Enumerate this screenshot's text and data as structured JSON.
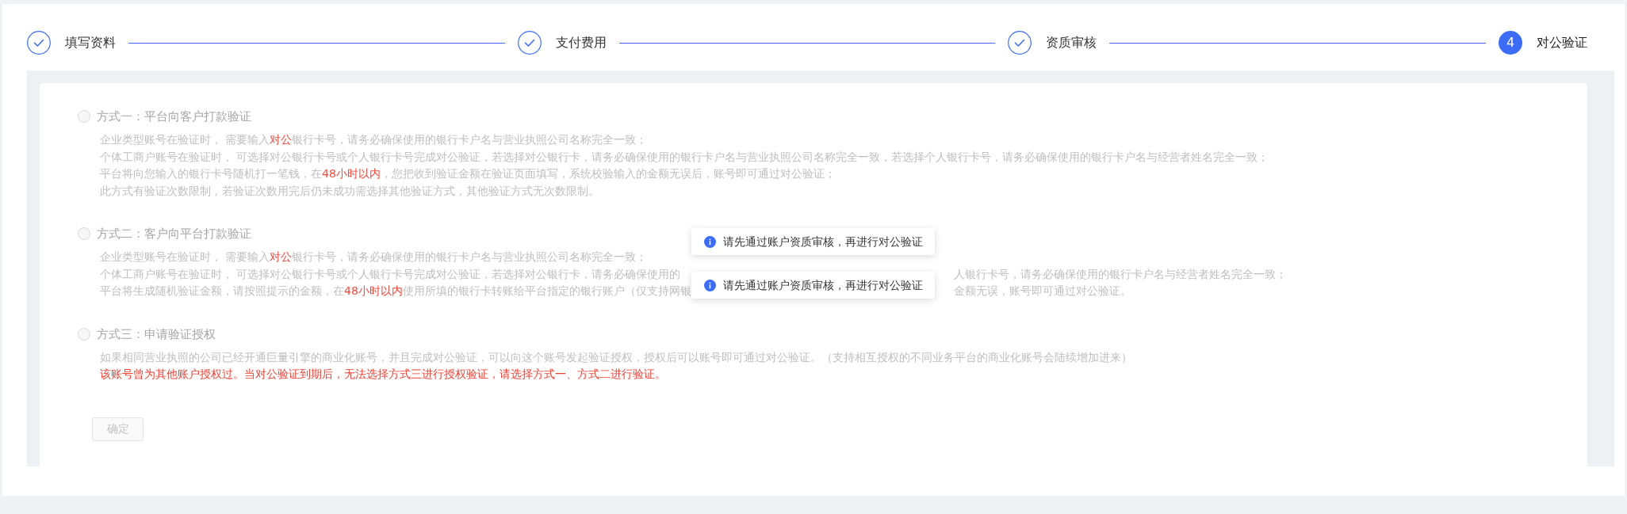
{
  "steps": [
    {
      "label": "填写资料",
      "completed": true
    },
    {
      "label": "支付费用",
      "completed": true
    },
    {
      "label": "资质审核",
      "completed": true
    },
    {
      "label": "对公验证",
      "completed": false,
      "number": "4"
    }
  ],
  "methods": [
    {
      "title": "方式一：平台向客户打款验证",
      "selected": false,
      "disabled": true,
      "lines": [
        {
          "kind": "normal",
          "segments": [
            {
              "text": "企业类型账号在验证时， 需要输入",
              "highlight": false
            },
            {
              "text": "对公",
              "highlight": true
            },
            {
              "text": "银行卡号，请务必确保使用的银行卡户名与营业执照公司名称完全一致；",
              "highlight": false
            }
          ]
        },
        {
          "kind": "normal",
          "segments": [
            {
              "text": "个体工商户账号在验证时， 可选择对公银行卡号或个人银行卡号完成对公验证，若选择对公银行卡，请务必确保使用的银行卡户名与营业执照公司名称完全一致，若选择个人银行卡号，请务必确保使用的银行卡户名与经营者姓名完全一致；",
              "highlight": false
            }
          ]
        },
        {
          "kind": "normal",
          "segments": [
            {
              "text": "平台将向您输入的银行卡号随机打一笔钱，在",
              "highlight": false
            },
            {
              "text": "48小时以内",
              "highlight": true
            },
            {
              "text": "，您把收到验证金额在验证页面填写，系统校验输入的金额无误后，账号即可通过对公验证；",
              "highlight": false
            }
          ]
        },
        {
          "kind": "normal",
          "segments": [
            {
              "text": "此方式有验证次数限制，若验证次数用完后仍未成功需选择其他验证方式，其他验证方式无次数限制。",
              "highlight": false
            }
          ]
        }
      ]
    },
    {
      "title": "方式二：客户向平台打款验证",
      "selected": false,
      "disabled": true,
      "lines": [
        {
          "kind": "normal",
          "segments": [
            {
              "text": "企业类型账号在验证时， 需要输入",
              "highlight": false
            },
            {
              "text": "对公",
              "highlight": true
            },
            {
              "text": "银行卡号，请务必确保使用的银行卡户名与营业执照公司名称完全一致；",
              "highlight": false
            }
          ]
        },
        {
          "kind": "occluded",
          "before": [
            {
              "text": "个体工商户账号在验证时， 可选择对公银行卡号或个人银行卡号完成对公验证，若选择对公银行卡，请务必确保使用的",
              "highlight": false
            }
          ],
          "after": [
            {
              "text": "人银行卡号，请务必确保使用的银行卡户名与经营者姓名完全一致；",
              "highlight": false
            }
          ]
        },
        {
          "kind": "occluded",
          "before": [
            {
              "text": "平台将生成随机验证金额，请按照提示的金额，在",
              "highlight": false
            },
            {
              "text": "48小时以内",
              "highlight": true
            },
            {
              "text": "使用所填的银行卡转账给平台指定的银行账户（仅支持网银",
              "highlight": false
            }
          ],
          "after": [
            {
              "text": "金额无误，账号即可通过对公验证。",
              "highlight": false
            }
          ]
        }
      ]
    },
    {
      "title": "方式三：申请验证授权",
      "selected": false,
      "disabled": true,
      "lines": [
        {
          "kind": "normal",
          "segments": [
            {
              "text": "如果相同营业执照的公司已经开通巨量引擎的商业化账号，并且完成对公验证，可以向这个账号发起验证授权，授权后可以账号即可通过对公验证。（支持相互授权的不同业务平台的商业化账号会陆续增加进来）",
              "highlight": false
            }
          ]
        },
        {
          "kind": "warning",
          "text": "该账号曾为其他账户授权过。当对公验证到期后，无法选择方式三进行授权验证，请选择方式一、方式二进行验证。"
        }
      ]
    }
  ],
  "confirm_button": {
    "label": "确定",
    "disabled": true
  },
  "toasts": [
    {
      "text": "请先通过账户资质审核，再进行对公验证"
    },
    {
      "text": "请先通过账户资质审核，再进行对公验证"
    }
  ]
}
